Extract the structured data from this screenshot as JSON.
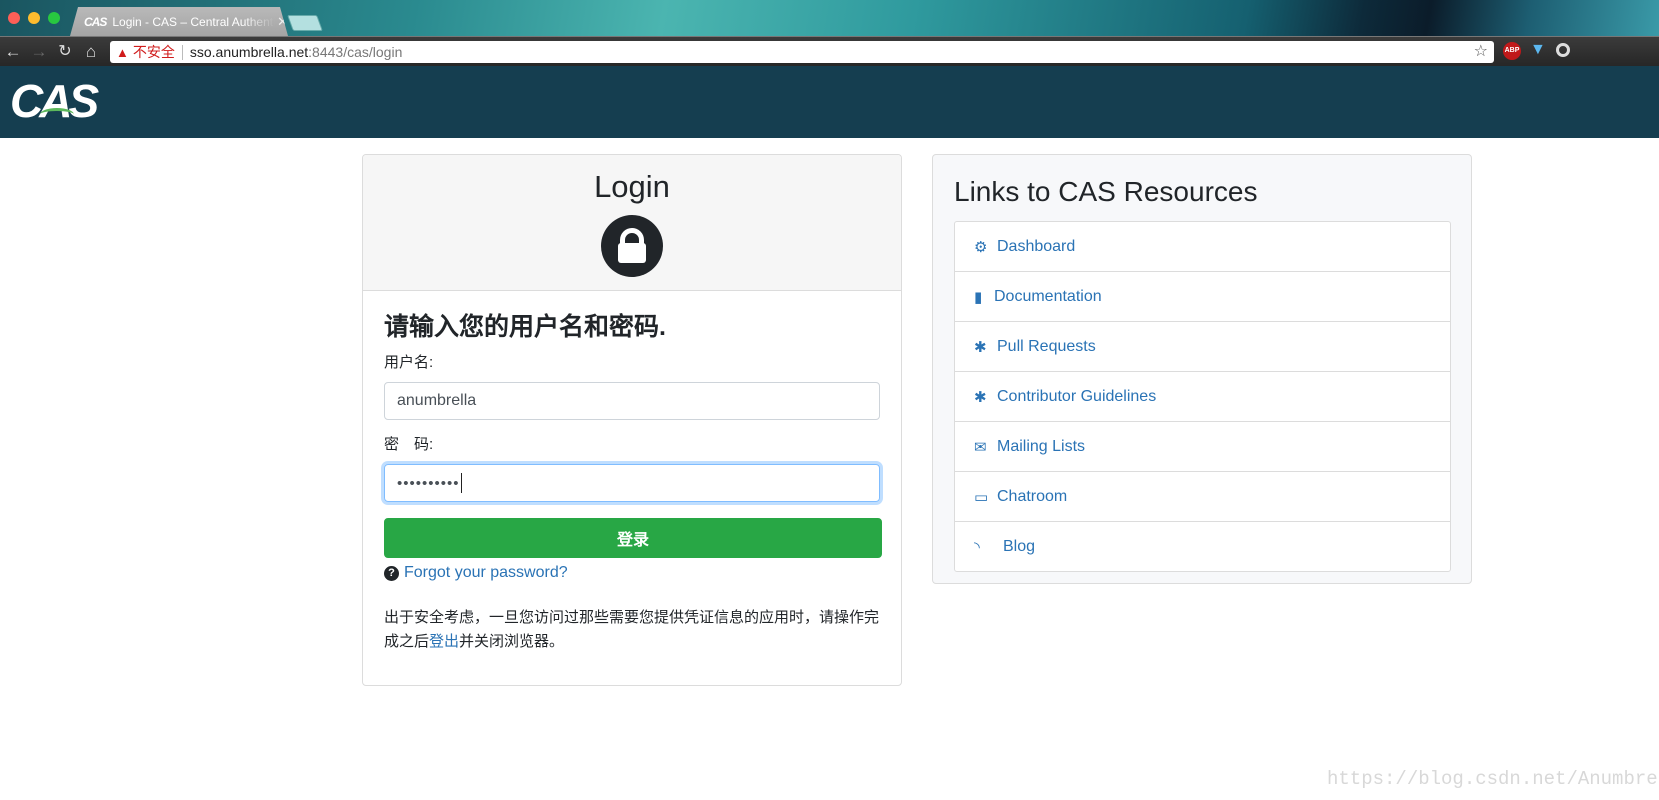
{
  "browser": {
    "tab_title": "Login - CAS – Central Authentication Service",
    "tab_favicon": "CAS",
    "security_label": "不安全",
    "url_host": "sso.anumbrella.net",
    "url_rest": ":8443/cas/login",
    "extensions": [
      "ABP"
    ]
  },
  "header": {
    "logo": "CAS"
  },
  "login": {
    "title": "Login",
    "heading": "请输入您的用户名和密码.",
    "username_label": "用户名:",
    "username_value": "anumbrella",
    "password_label": "密　码:",
    "password_value": "••••••••••",
    "submit_label": "登录",
    "forgot_label": "Forgot your password?",
    "notice_part1": "出于安全考虑，一旦您访问过那些需要您提供凭证信息的应用时，请操作完成之后",
    "notice_link": "登出",
    "notice_part2": "并关闭浏览器。"
  },
  "resources": {
    "title": "Links to CAS Resources",
    "items": [
      {
        "label": "Dashboard",
        "icon": "cogs-icon"
      },
      {
        "label": "Documentation",
        "icon": "file-icon"
      },
      {
        "label": "Pull Requests",
        "icon": "bug-icon"
      },
      {
        "label": "Contributor Guidelines",
        "icon": "bug-icon"
      },
      {
        "label": "Mailing Lists",
        "icon": "envelope-icon"
      },
      {
        "label": "Chatroom",
        "icon": "comment-icon"
      },
      {
        "label": "Blog",
        "icon": "rss-icon"
      }
    ]
  },
  "colors": {
    "header_bg": "#153e50",
    "link": "#2a73b5",
    "submit": "#28a745"
  },
  "watermark": "https://blog.csdn.net/Anumbrella"
}
